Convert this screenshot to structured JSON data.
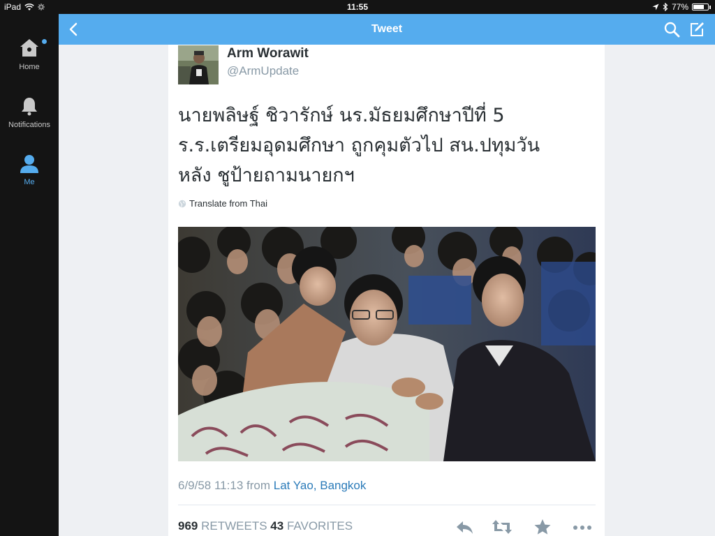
{
  "status_bar": {
    "device": "iPad",
    "time": "11:55",
    "battery": "77%",
    "battery_level": 0.77
  },
  "sidebar": {
    "items": [
      {
        "label": "Home",
        "icon": "home-icon",
        "has_notification_dot": true
      },
      {
        "label": "Notifications",
        "icon": "bell-icon"
      },
      {
        "label": "Me",
        "icon": "person-icon",
        "active": true
      }
    ]
  },
  "topbar": {
    "title": "Tweet",
    "back_icon": "chevron-left-icon",
    "search_icon": "search-icon",
    "compose_icon": "compose-icon"
  },
  "tweet": {
    "author_name": "Arm Worawit",
    "author_handle": "@ArmUpdate",
    "text_lines": [
      "นายพลิษฐ์ ชิวารักษ์ นร.มัธยมศึกษาปีที่ 5",
      "ร.ร.เตรียมอุดมศึกษา ถูกคุมตัวไป สน.ปทุมวัน",
      "หลัง ชูป้ายถามนายกฯ"
    ],
    "translate_label": "Translate from Thai",
    "timestamp": "6/9/58 11:13",
    "from_label": "from",
    "location": "Lat Yao, Bangkok",
    "retweets_count": "969",
    "retweets_label": "RETWEETS",
    "favorites_count": "43",
    "favorites_label": "FAVORITES"
  },
  "colors": {
    "accent": "#55acee",
    "link": "#2b7bb9",
    "sidebar_bg": "#141414",
    "muted": "#8899a6"
  }
}
